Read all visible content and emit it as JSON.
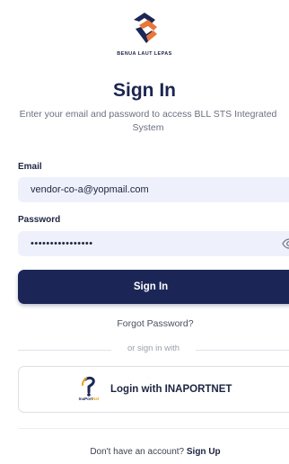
{
  "brand": {
    "name": "BENUA LAUT LEPAS",
    "logo_icon": "bll-logo-icon",
    "colors": {
      "navy": "#1c2656",
      "orange": "#e8773a"
    }
  },
  "heading": {
    "title": "Sign In",
    "subtitle": "Enter your email and password to access BLL STS Integrated System"
  },
  "form": {
    "email_label": "Email",
    "email_value": "vendor-co-a@yopmail.com",
    "password_label": "Password",
    "password_value": "••••••••••••••••",
    "password_toggle_icon": "eye-icon",
    "submit_label": "Sign In",
    "forgot_label": "Forgot Password?"
  },
  "alt_signin": {
    "divider_text": "or sign in with",
    "inaportnet_label": "Login with INAPORTNET",
    "inaportnet_logo_text_a": "InaPort",
    "inaportnet_logo_text_b": "Net"
  },
  "footer": {
    "prompt": "Don't have an account?",
    "signup_label": "Sign Up"
  }
}
